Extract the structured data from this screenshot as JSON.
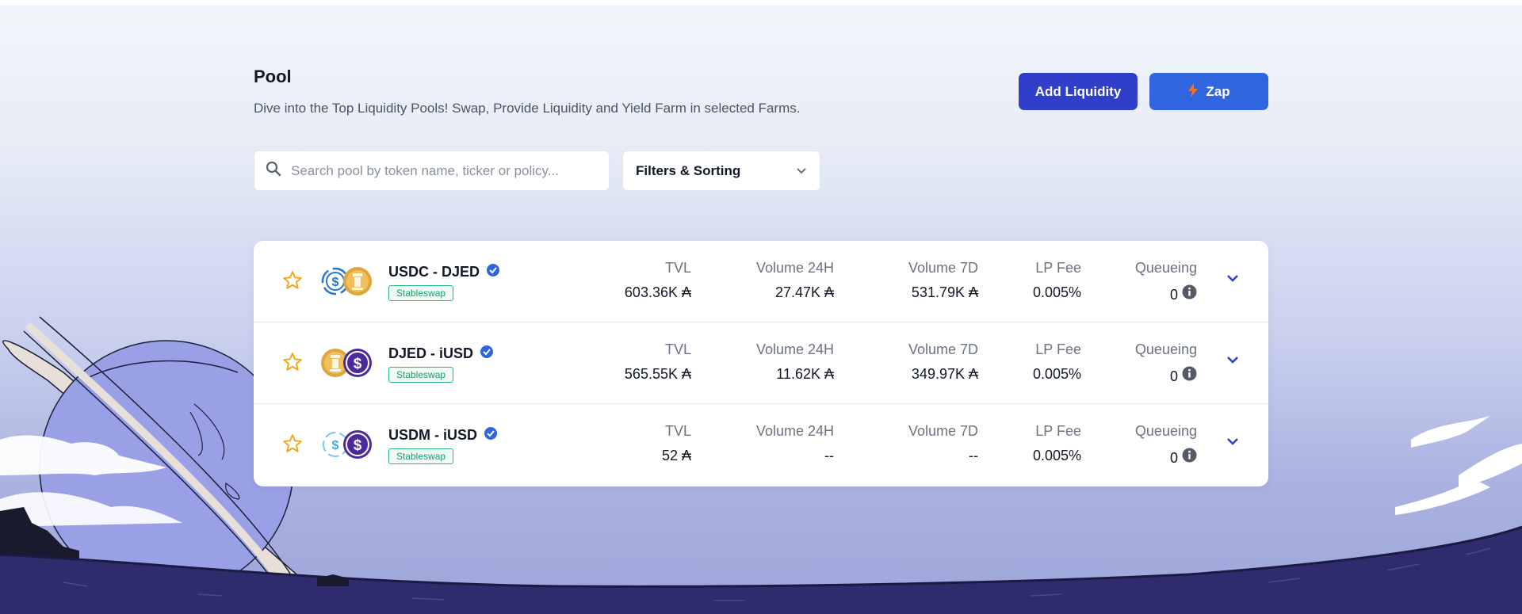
{
  "header": {
    "title": "Pool",
    "subtitle": "Dive into the Top Liquidity Pools! Swap, Provide Liquidity and Yield Farm in selected Farms.",
    "add_liquidity_label": "Add Liquidity",
    "zap_label": "Zap"
  },
  "search": {
    "placeholder": "Search pool by token name, ticker or policy..."
  },
  "filters": {
    "label": "Filters & Sorting"
  },
  "columns": {
    "tvl": "TVL",
    "volume_24h": "Volume 24H",
    "volume_7d": "Volume 7D",
    "lp_fee": "LP Fee",
    "queueing": "Queueing"
  },
  "pools": [
    {
      "pair": "USDC - DJED",
      "badge": "Stableswap",
      "tvl": "603.36K ₳",
      "volume_24h": "27.47K ₳",
      "volume_7d": "531.79K ₳",
      "lp_fee": "0.005%",
      "queueing": "0"
    },
    {
      "pair": "DJED - iUSD",
      "badge": "Stableswap",
      "tvl": "565.55K ₳",
      "volume_24h": "11.62K ₳",
      "volume_7d": "349.97K ₳",
      "lp_fee": "0.005%",
      "queueing": "0"
    },
    {
      "pair": "USDM - iUSD",
      "badge": "Stableswap",
      "tvl": "52 ₳",
      "volume_24h": "--",
      "volume_7d": "--",
      "lp_fee": "0.005%",
      "queueing": "0"
    }
  ],
  "icons": {
    "search": "search-icon",
    "chevron": "chevron-down-icon",
    "star": "star-icon",
    "verified": "verified-badge-icon",
    "info": "info-icon",
    "bolt": "lightning-icon"
  },
  "colors": {
    "primary": "#2f3fc9",
    "zap": "#2f66e0",
    "stableswap": "#16a067",
    "chevron": "#2f3fc9"
  }
}
